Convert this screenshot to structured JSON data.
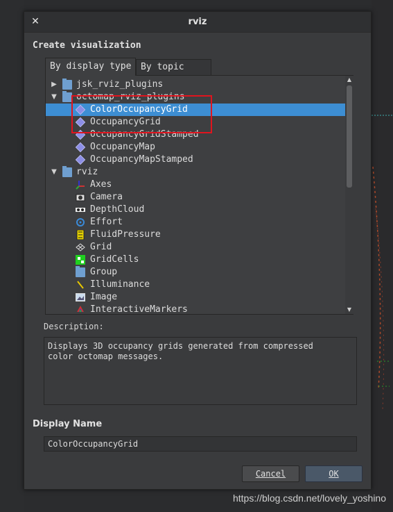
{
  "window": {
    "title": "rviz"
  },
  "dialog": {
    "heading": "Create visualization"
  },
  "tabs": [
    {
      "label": "By display type",
      "active": true
    },
    {
      "label": "By topic",
      "active": false
    }
  ],
  "tree": [
    {
      "label": "jsk_rviz_plugins",
      "icon": "folder-icon",
      "expanded": false
    },
    {
      "label": "octomap_rviz_plugins",
      "icon": "folder-icon",
      "expanded": true
    },
    {
      "label": "ColorOccupancyGrid",
      "icon": "diamond-plugin-icon",
      "selected": true
    },
    {
      "label": "OccupancyGrid",
      "icon": "diamond-plugin-icon"
    },
    {
      "label": "OccupancyGridStamped",
      "icon": "diamond-plugin-icon"
    },
    {
      "label": "OccupancyMap",
      "icon": "diamond-plugin-icon"
    },
    {
      "label": "OccupancyMapStamped",
      "icon": "diamond-plugin-icon"
    },
    {
      "label": "rviz",
      "icon": "folder-icon",
      "expanded": true
    },
    {
      "label": "Axes",
      "icon": "axes-icon"
    },
    {
      "label": "Camera",
      "icon": "camera-icon"
    },
    {
      "label": "DepthCloud",
      "icon": "depthcloud-icon"
    },
    {
      "label": "Effort",
      "icon": "effort-icon"
    },
    {
      "label": "FluidPressure",
      "icon": "fluidpressure-icon"
    },
    {
      "label": "Grid",
      "icon": "grid-icon"
    },
    {
      "label": "GridCells",
      "icon": "gridcells-icon"
    },
    {
      "label": "Group",
      "icon": "group-icon"
    },
    {
      "label": "Illuminance",
      "icon": "illuminance-icon"
    },
    {
      "label": "Image",
      "icon": "image-icon"
    },
    {
      "label": "InteractiveMarkers",
      "icon": "interactivemarkers-icon"
    }
  ],
  "description": {
    "label": "Description:",
    "text": "Displays 3D occupancy grids generated from compressed\ncolor octomap messages."
  },
  "display_name": {
    "label": "Display Name",
    "value": "ColorOccupancyGrid"
  },
  "buttons": {
    "cancel": "Cancel",
    "ok": "OK"
  },
  "watermark": "https://blog.csdn.net/lovely_yoshino",
  "colors": {
    "selection": "#3d8ed3",
    "annotation": "#e0141e",
    "folder": "#6f9fd0"
  }
}
